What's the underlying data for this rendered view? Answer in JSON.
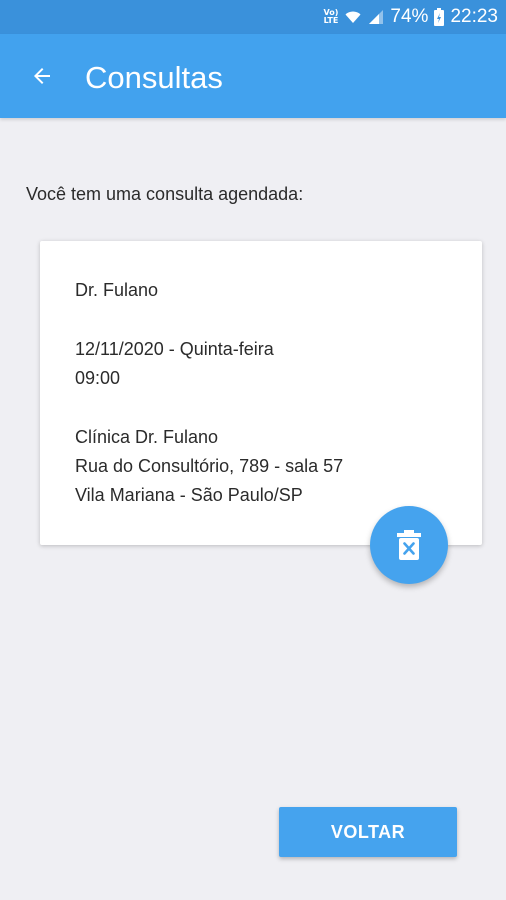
{
  "status_bar": {
    "volte_top": "Vo)",
    "volte_bottom": "LTE",
    "battery_percent": "74%",
    "time": "22:23",
    "icons": [
      "volte-icon",
      "wifi-icon",
      "signal-icon",
      "battery-charging-icon"
    ]
  },
  "app_bar": {
    "title": "Consultas",
    "back_icon": "arrow-back-icon"
  },
  "content": {
    "intro": "Você tem uma consulta agendada:"
  },
  "appointment": {
    "doctor": "Dr. Fulano",
    "date": "12/11/2020 - Quinta-feira",
    "time": "09:00",
    "clinic": "Clínica Dr. Fulano",
    "address_line1": "Rua do Consultório, 789 - sala 57",
    "address_line2": "Vila Mariana - São Paulo/SP"
  },
  "delete_fab": {
    "icon": "trash-delete-icon"
  },
  "back_button": {
    "label": "VOLTAR"
  },
  "colors": {
    "status_bar": "#3a91db",
    "app_bar": "#42a2ee",
    "accent": "#45a3ee",
    "background": "#efeff3"
  }
}
